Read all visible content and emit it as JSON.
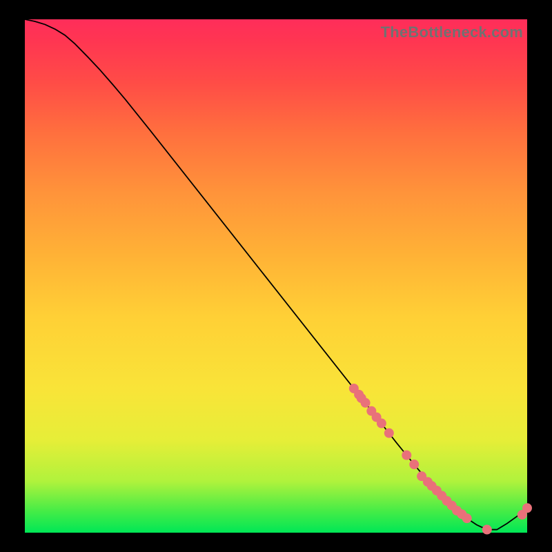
{
  "watermark": "TheBottleneck.com",
  "chart_data": {
    "type": "line",
    "title": "",
    "xlabel": "",
    "ylabel": "",
    "xlim": [
      0,
      100
    ],
    "ylim": [
      0,
      100
    ],
    "curve": {
      "x": [
        0,
        2,
        4,
        6,
        8,
        10,
        12.5,
        15,
        17.5,
        20,
        25,
        30,
        35,
        40,
        45,
        50,
        55,
        60,
        65,
        70,
        72,
        74,
        76,
        78,
        80,
        82,
        84,
        86,
        88,
        90,
        92,
        94,
        96,
        98,
        100
      ],
      "y": [
        100,
        99.6,
        99,
        98.1,
        96.9,
        95.2,
        92.7,
        90.1,
        87.3,
        84.4,
        78.3,
        72.1,
        65.9,
        59.7,
        53.5,
        47.3,
        41.1,
        34.9,
        28.7,
        22.5,
        20,
        17.5,
        15.1,
        12.7,
        10.4,
        8.2,
        6.2,
        4.3,
        2.8,
        1.5,
        0.6,
        0.6,
        1.8,
        3.2,
        4.8
      ]
    },
    "points": {
      "x": [
        65.5,
        66.5,
        67,
        67.8,
        69,
        70,
        71,
        72.5,
        76,
        77.5,
        79,
        80.2,
        81,
        82,
        83,
        84,
        85,
        86,
        87,
        88,
        92,
        99,
        100
      ],
      "y": [
        28.1,
        26.9,
        26.2,
        25.3,
        23.7,
        22.5,
        21.3,
        19.4,
        15.1,
        13.3,
        11,
        9.9,
        9.1,
        8.2,
        7.2,
        6.2,
        5.3,
        4.3,
        3.6,
        2.8,
        0.6,
        3.5,
        4.8
      ],
      "color": "#e9717a",
      "radius": 7
    },
    "curve_color": "#000000",
    "curve_width": 1.8
  }
}
